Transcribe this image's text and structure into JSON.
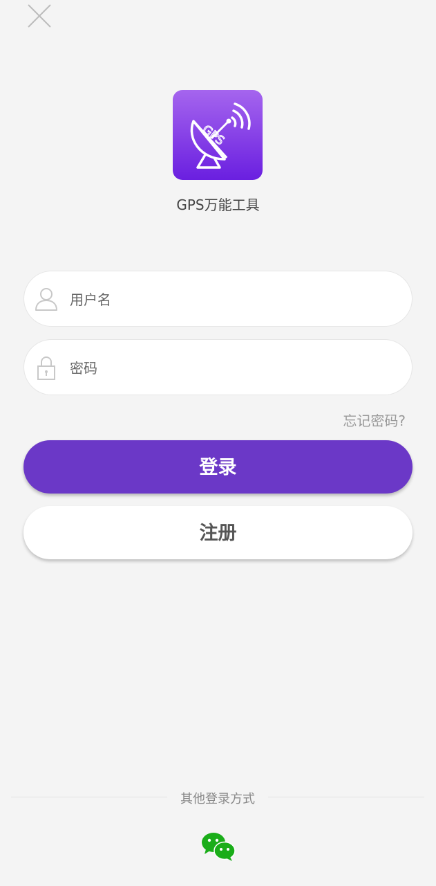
{
  "app": {
    "name": "GPS万能工具",
    "logo_text": "GPS"
  },
  "login_form": {
    "username_placeholder": "用户名",
    "password_placeholder": "密码",
    "forgot_password": "忘记密码?",
    "login_label": "登录",
    "register_label": "注册"
  },
  "other_login": {
    "label": "其他登录方式",
    "methods": [
      "wechat"
    ]
  },
  "icons": {
    "close": "close-icon",
    "user": "user-icon",
    "lock": "lock-icon",
    "wechat": "wechat-icon",
    "logo": "satellite-dish-icon"
  },
  "colors": {
    "primary": "#6b38c7",
    "background": "#f4f4f4",
    "wechat": "#1aad19"
  }
}
